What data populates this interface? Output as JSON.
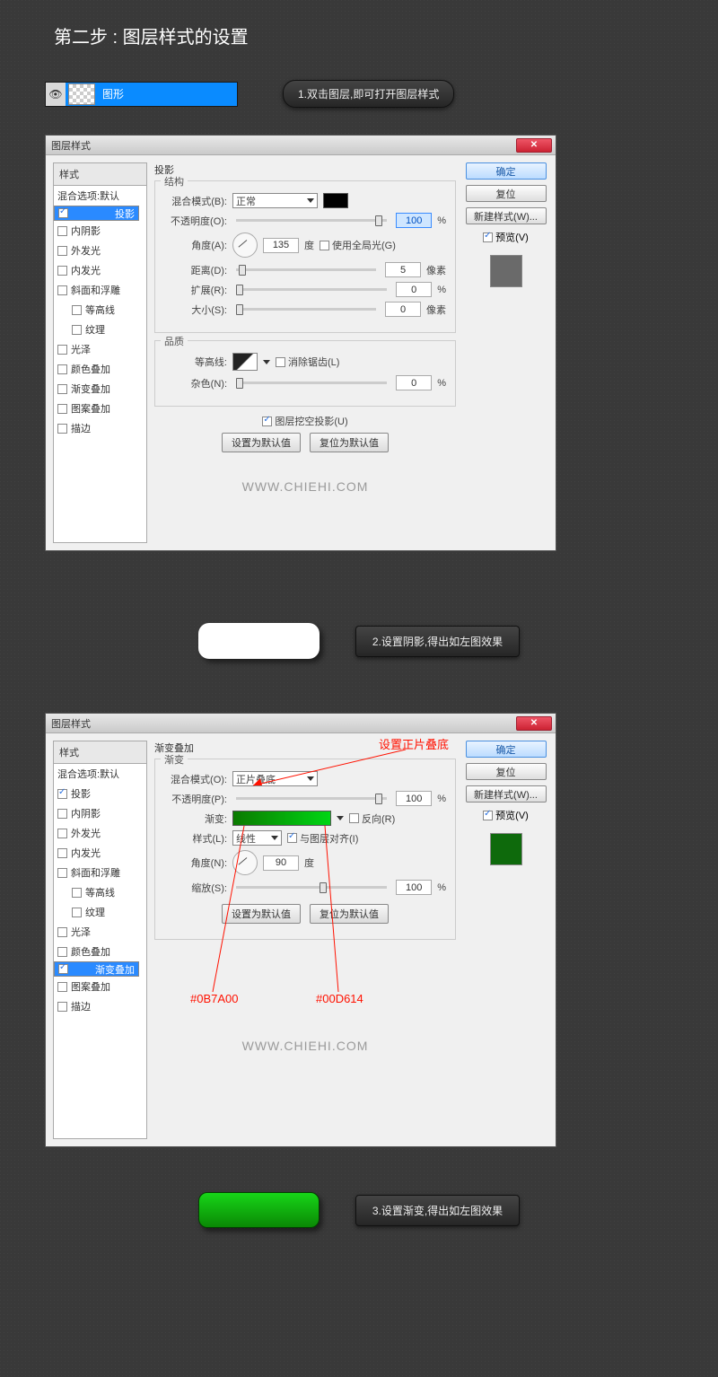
{
  "page_title": "第二步 : 图层样式的设置",
  "layer": {
    "name": "图形"
  },
  "callouts": {
    "c1": "1.双击图层,即可打开图层样式",
    "c2": "2.设置阴影,得出如左图效果",
    "c3": "3.设置渐变,得出如左图效果"
  },
  "dialog1": {
    "title": "图层样式",
    "styles_header": "样式",
    "blend_default": "混合选项:默认",
    "items": [
      "投影",
      "内阴影",
      "外发光",
      "内发光",
      "斜面和浮雕",
      "等高线",
      "纹理",
      "光泽",
      "颜色叠加",
      "渐变叠加",
      "图案叠加",
      "描边"
    ],
    "checked": {
      "投影": true
    },
    "selected": "投影",
    "section_title": "投影",
    "group1": "结构",
    "blend_mode_lbl": "混合模式(B):",
    "blend_mode_val": "正常",
    "opacity_lbl": "不透明度(O):",
    "opacity_val": "100",
    "pct": "%",
    "angle_lbl": "角度(A):",
    "angle_val": "135",
    "deg": "度",
    "global_light": "使用全局光(G)",
    "distance_lbl": "距离(D):",
    "distance_val": "5",
    "px": "像素",
    "spread_lbl": "扩展(R):",
    "spread_val": "0",
    "size_lbl": "大小(S):",
    "size_val": "0",
    "group2": "品质",
    "contour_lbl": "等高线:",
    "antialias": "消除锯齿(L)",
    "noise_lbl": "杂色(N):",
    "noise_val": "0",
    "knockout": "图层挖空投影(U)",
    "btn_default": "设置为默认值",
    "btn_reset": "复位为默认值",
    "btn_ok": "确定",
    "btn_cancel": "复位",
    "btn_new": "新建样式(W)...",
    "preview_lbl": "预览(V)",
    "watermark": "WWW.CHIEHI.COM"
  },
  "dialog2": {
    "title": "图层样式",
    "section_title": "渐变叠加",
    "group1": "渐变",
    "blend_mode_lbl": "混合模式(O):",
    "blend_mode_val": "正片叠底",
    "opacity_lbl": "不透明度(P):",
    "opacity_val": "100",
    "gradient_lbl": "渐变:",
    "reverse": "反向(R)",
    "style_lbl": "样式(L):",
    "style_val": "线性",
    "align": "与图层对齐(I)",
    "angle_lbl": "角度(N):",
    "angle_val": "90",
    "scale_lbl": "缩放(S):",
    "scale_val": "100",
    "selected": "渐变叠加",
    "checked": {
      "投影": true,
      "渐变叠加": true
    },
    "annot_title": "设置正片叠底",
    "annot_hex1": "#0B7A00",
    "annot_hex2": "#00D614"
  }
}
